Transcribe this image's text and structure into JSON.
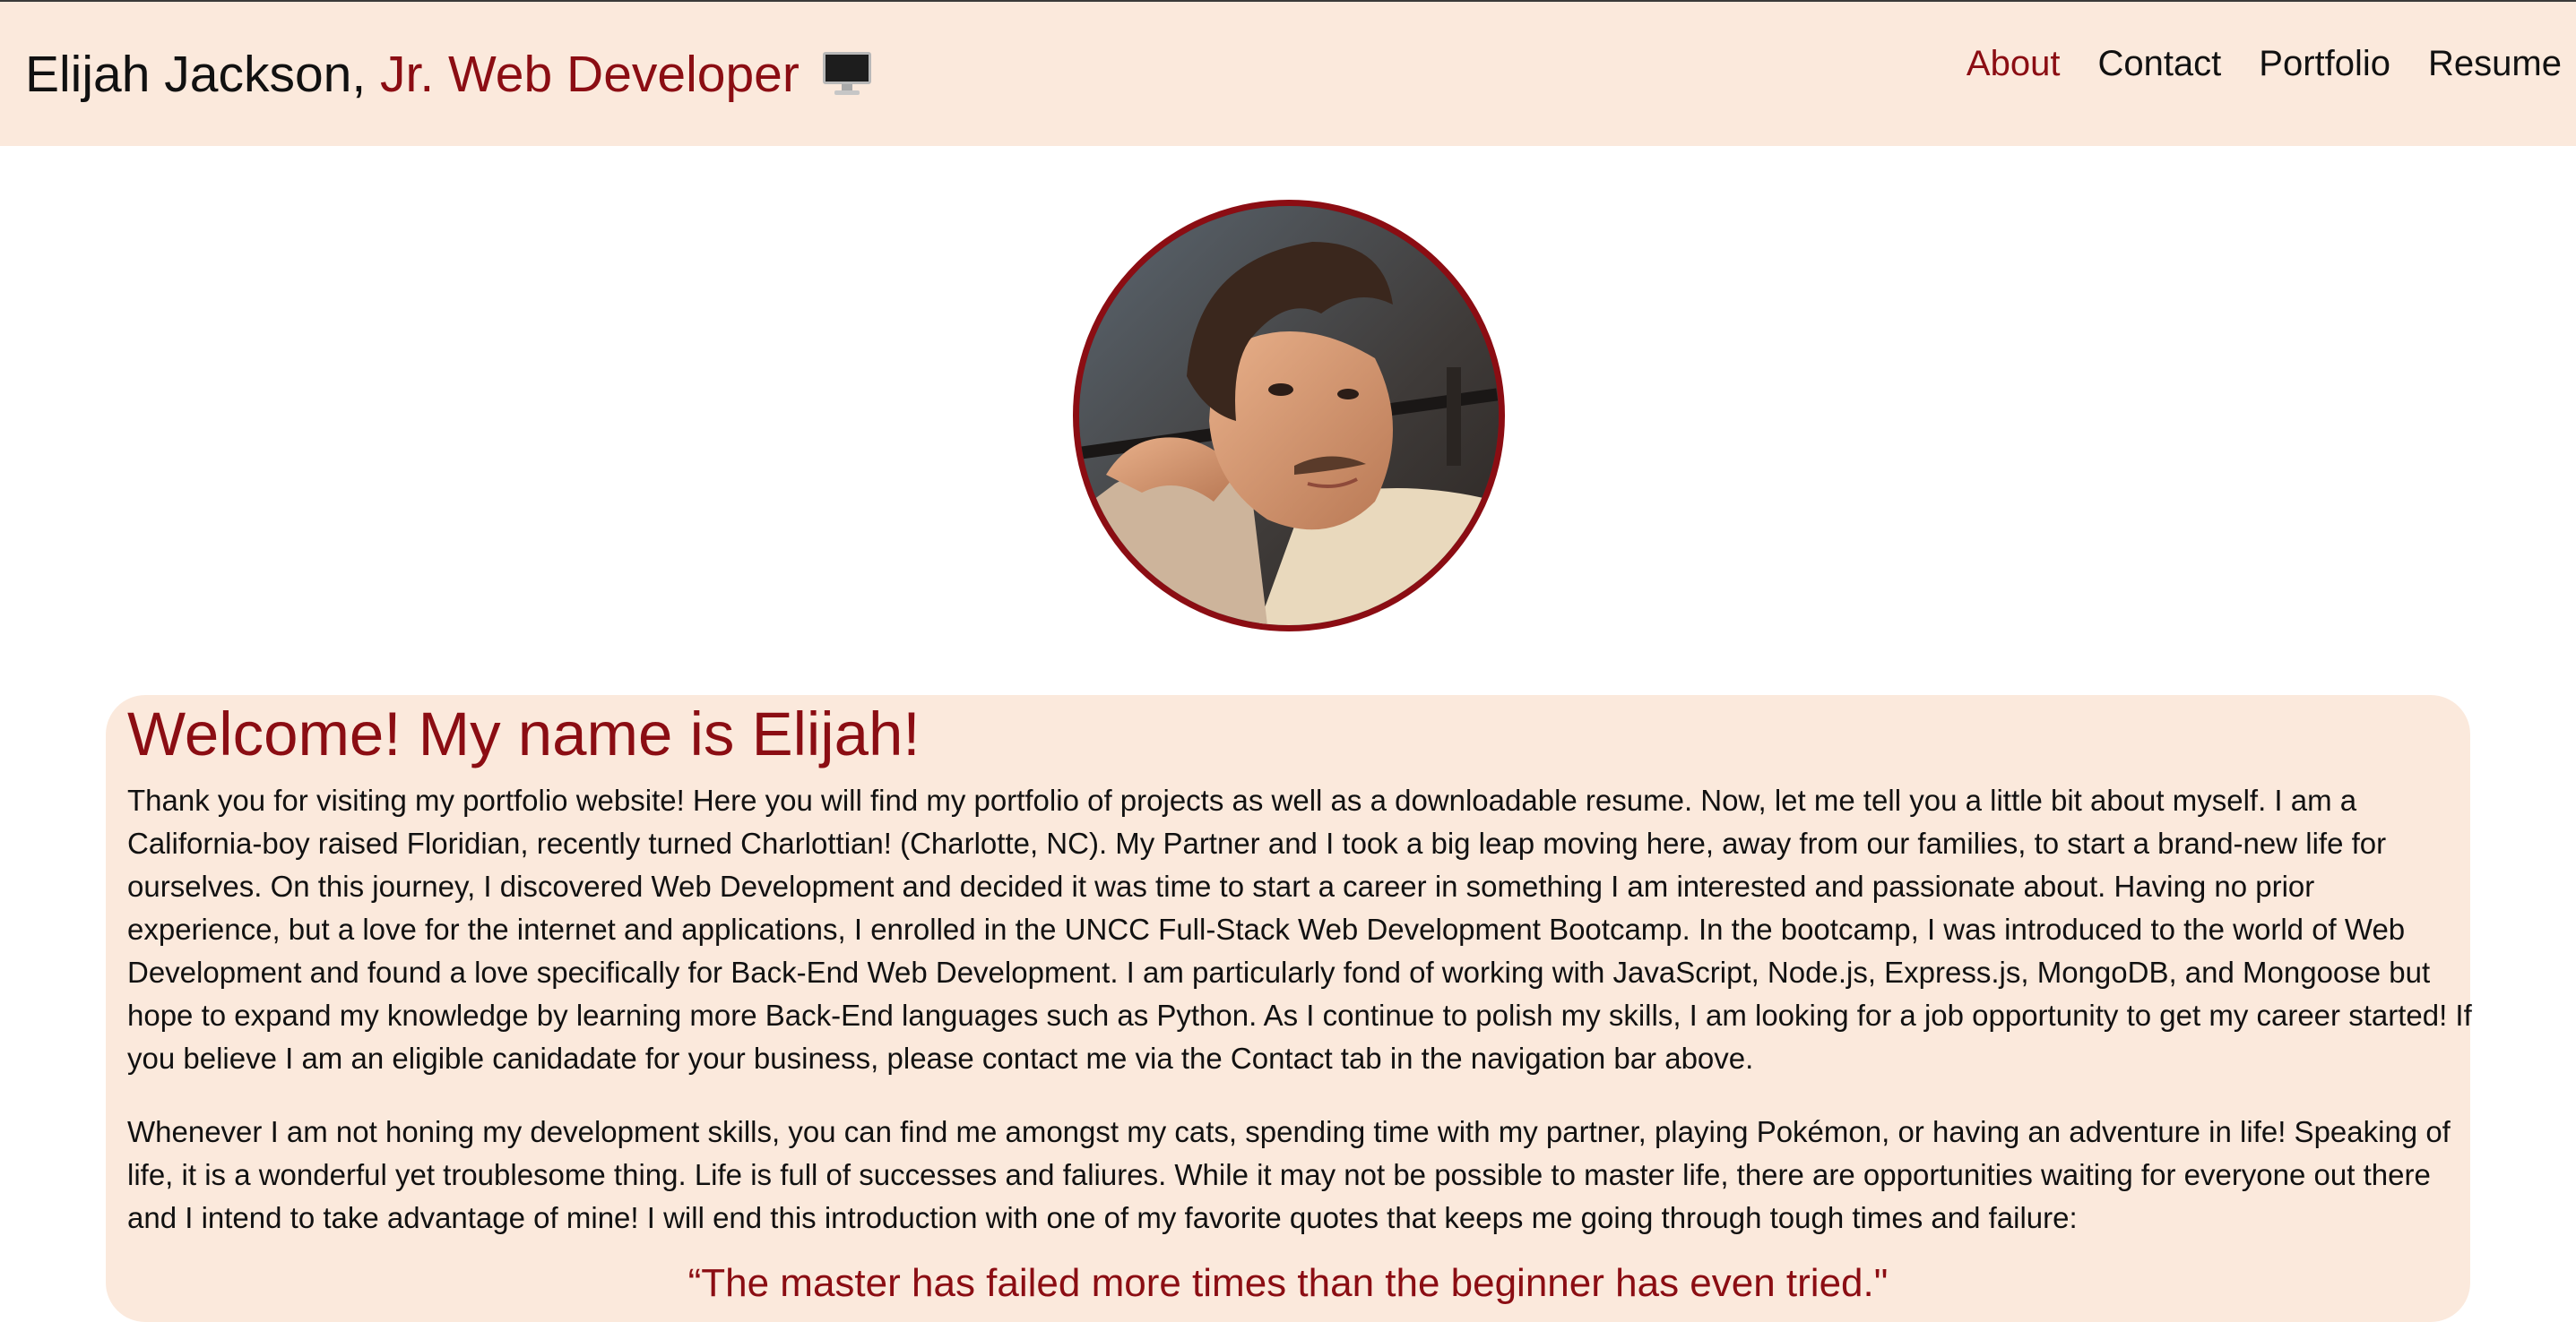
{
  "header": {
    "name": "Elijah Jackson,",
    "role": "Jr. Web Developer",
    "icon": "desktop-computer-icon"
  },
  "nav": {
    "items": [
      {
        "label": "About",
        "active": true
      },
      {
        "label": "Contact",
        "active": false
      },
      {
        "label": "Portfolio",
        "active": false
      },
      {
        "label": "Resume",
        "active": false
      }
    ]
  },
  "profile": {
    "avatar": "profile-photo"
  },
  "about": {
    "heading": "Welcome! My name is Elijah!",
    "paragraph1": "Thank you for visiting my portfolio website! Here you will find my portfolio of projects as well as a downloadable resume. Now, let me tell you a little bit about myself. I am a California-boy raised Floridian, recently turned Charlottian! (Charlotte, NC). My Partner and I took a big leap moving here, away from our families, to start a brand-new life for ourselves. On this journey, I discovered Web Development and decided it was time to start a career in something I am interested and passionate about. Having no prior experience, but a love for the internet and applications, I enrolled in the UNCC Full-Stack Web Development Bootcamp. In the bootcamp, I was introduced to the world of Web Development and found a love specifically for Back-End Web Development. I am particularly fond of working with JavaScript, Node.js, Express.js, MongoDB, and Mongoose but hope to expand my knowledge by learning more Back-End languages such as Python. As I continue to polish my skills, I am looking for a job opportunity to get my career started! If you believe I am an eligible canidadate for your business, please contact me via the Contact tab in the navigation bar above.",
    "paragraph2": "Whenever I am not honing my development skills, you can find me amongst my cats, spending time with my partner, playing Pokémon, or having an adventure in life! Speaking of life, it is a wonderful yet troublesome thing. Life is full of successes and faliures. While it may not be possible to master life, there are opportunities waiting for everyone out there and I intend to take advantage of mine! I will end this introduction with one of my favorite quotes that keeps me going through tough times and failure:",
    "quote": "“The master has failed more times than the beginner has even tried.\""
  },
  "colors": {
    "accent": "#8b0d13",
    "header_bg": "#fbe9dc",
    "card_bg": "#fbe9dc",
    "page_bg": "#ffffff"
  }
}
